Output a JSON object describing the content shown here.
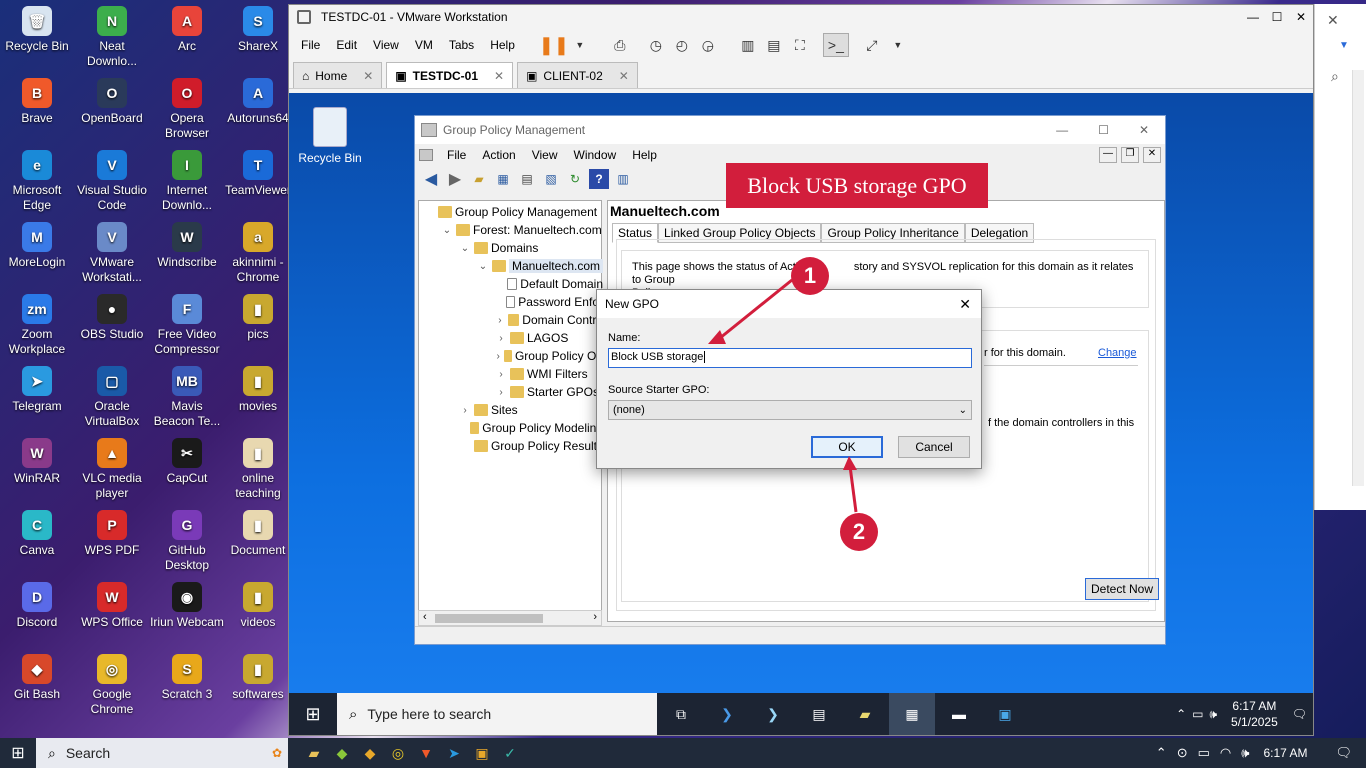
{
  "desktop_icons": [
    {
      "label": "Recycle Bin",
      "color": "#d8e4f0",
      "glyph": "🗑"
    },
    {
      "label": "Neat Downlo...",
      "color": "#3cae4c",
      "glyph": "N"
    },
    {
      "label": "Arc",
      "color": "#e8443a",
      "glyph": "A"
    },
    {
      "label": "ShareX",
      "color": "#2a8ae8",
      "glyph": "S"
    },
    {
      "label": "Brave",
      "color": "#f0592a",
      "glyph": "B"
    },
    {
      "label": "OpenBoard",
      "color": "#2a3a5a",
      "glyph": "O"
    },
    {
      "label": "Opera Browser",
      "color": "#d01c2a",
      "glyph": "O"
    },
    {
      "label": "Autoruns64",
      "color": "#2a6ad8",
      "glyph": "A"
    },
    {
      "label": "Microsoft Edge",
      "color": "#1a8ad8",
      "glyph": "e"
    },
    {
      "label": "Visual Studio Code",
      "color": "#1a7ad8",
      "glyph": "V"
    },
    {
      "label": "Internet Downlo...",
      "color": "#3a9a3a",
      "glyph": "I"
    },
    {
      "label": "TeamViewer",
      "color": "#1a6ad8",
      "glyph": "T"
    },
    {
      "label": "MoreLogin",
      "color": "#3a7ae8",
      "glyph": "M"
    },
    {
      "label": "VMware Workstati...",
      "color": "#6a8ac8",
      "glyph": "V"
    },
    {
      "label": "Windscribe",
      "color": "#2a3a4a",
      "glyph": "W"
    },
    {
      "label": "akinnimi - Chrome",
      "color": "#d8a82a",
      "glyph": "a"
    },
    {
      "label": "Zoom Workplace",
      "color": "#2a7ae8",
      "glyph": "zm"
    },
    {
      "label": "OBS Studio",
      "color": "#2a2a2a",
      "glyph": "●"
    },
    {
      "label": "Free Video Compressor",
      "color": "#5a8ad8",
      "glyph": "F"
    },
    {
      "label": "pics",
      "color": "#c8a830",
      "glyph": "▮"
    },
    {
      "label": "Telegram",
      "color": "#2a9ae0",
      "glyph": "➤"
    },
    {
      "label": "Oracle VirtualBox",
      "color": "#1a5aa8",
      "glyph": "▢"
    },
    {
      "label": "Mavis Beacon Te...",
      "color": "#3a5ab8",
      "glyph": "MB"
    },
    {
      "label": "movies",
      "color": "#c8a830",
      "glyph": "▮"
    },
    {
      "label": "WinRAR",
      "color": "#8a3a8a",
      "glyph": "W"
    },
    {
      "label": "VLC media player",
      "color": "#e87a1a",
      "glyph": "▲"
    },
    {
      "label": "CapCut",
      "color": "#1a1a1a",
      "glyph": "✂"
    },
    {
      "label": "online teaching",
      "color": "#e8d8b0",
      "glyph": "▮"
    },
    {
      "label": "Canva",
      "color": "#2ab8c8",
      "glyph": "C"
    },
    {
      "label": "WPS PDF",
      "color": "#d82a2a",
      "glyph": "P"
    },
    {
      "label": "GitHub Desktop",
      "color": "#7a3ab8",
      "glyph": "G"
    },
    {
      "label": "Document",
      "color": "#e8d8b0",
      "glyph": "▮"
    },
    {
      "label": "Discord",
      "color": "#5a6ae8",
      "glyph": "D"
    },
    {
      "label": "WPS Office",
      "color": "#d82a2a",
      "glyph": "W"
    },
    {
      "label": "Iriun Webcam",
      "color": "#1a1a1a",
      "glyph": "◉"
    },
    {
      "label": "videos",
      "color": "#c8a830",
      "glyph": "▮"
    },
    {
      "label": "Git Bash",
      "color": "#d8482a",
      "glyph": "◆"
    },
    {
      "label": "Google Chrome",
      "color": "#e8b82a",
      "glyph": "◎"
    },
    {
      "label": "Scratch 3",
      "color": "#e8a81a",
      "glyph": "S"
    },
    {
      "label": "softwares",
      "color": "#c8a830",
      "glyph": "▮"
    }
  ],
  "vmware": {
    "title": "TESTDC-01 - VMware Workstation",
    "menu": [
      "File",
      "Edit",
      "View",
      "VM",
      "Tabs",
      "Help"
    ],
    "tabs": [
      {
        "label": "Home"
      },
      {
        "label": "TESTDC-01"
      },
      {
        "label": "CLIENT-02"
      }
    ]
  },
  "guest": {
    "recycle_bin": "Recycle Bin",
    "search_placeholder": "Type here to search",
    "time": "6:17 AM",
    "date": "5/1/2025"
  },
  "gpm": {
    "title": "Group Policy Management",
    "menu": [
      "File",
      "Action",
      "View",
      "Window",
      "Help"
    ],
    "tree": [
      {
        "label": "Group Policy Management",
        "indent": 0,
        "ex": ""
      },
      {
        "label": "Forest: Manueltech.com",
        "indent": 1,
        "ex": "⌄"
      },
      {
        "label": "Domains",
        "indent": 2,
        "ex": "⌄"
      },
      {
        "label": "Manueltech.com",
        "indent": 3,
        "ex": "⌄",
        "selected": true
      },
      {
        "label": "Default Domain",
        "indent": 4,
        "ex": ""
      },
      {
        "label": "Password Enfor",
        "indent": 4,
        "ex": ""
      },
      {
        "label": "Domain Contro",
        "indent": 4,
        "ex": "›"
      },
      {
        "label": "LAGOS",
        "indent": 4,
        "ex": "›"
      },
      {
        "label": "Group Policy Ob",
        "indent": 4,
        "ex": "›"
      },
      {
        "label": "WMI Filters",
        "indent": 4,
        "ex": "›"
      },
      {
        "label": "Starter GPOs",
        "indent": 4,
        "ex": "›"
      },
      {
        "label": "Sites",
        "indent": 2,
        "ex": "›"
      },
      {
        "label": "Group Policy Modeling",
        "indent": 2,
        "ex": ""
      },
      {
        "label": "Group Policy Results",
        "indent": 2,
        "ex": ""
      }
    ],
    "domain_title": "Manueltech.com",
    "tabs": [
      "Status",
      "Linked Group Policy Objects",
      "Group Policy Inheritance",
      "Delegation"
    ],
    "status_text": "This page shows the status of Active Directory and SYSVOL replication for this domain as it relates to Group Policy.",
    "status_text_short": "This page shows the status of Activ",
    "status_text_tail": "story and SYSVOL replication for this domain as it relates to Group",
    "status_text_line2": "Policy.",
    "for_domain": "r for this domain.",
    "change": "Change",
    "dc_text": "f the domain controllers in this",
    "detect_now": "Detect Now"
  },
  "dialog": {
    "title": "New GPO",
    "name_label": "Name:",
    "name_value": "Block USB storage",
    "starter_label": "Source Starter GPO:",
    "starter_value": "(none)",
    "ok": "OK",
    "cancel": "Cancel"
  },
  "callout": {
    "banner": "Block USB storage GPO",
    "step1": "1",
    "step2": "2",
    "color": "#d21e3c"
  },
  "host_taskbar": {
    "search": "Search",
    "time": "6:17 AM"
  }
}
